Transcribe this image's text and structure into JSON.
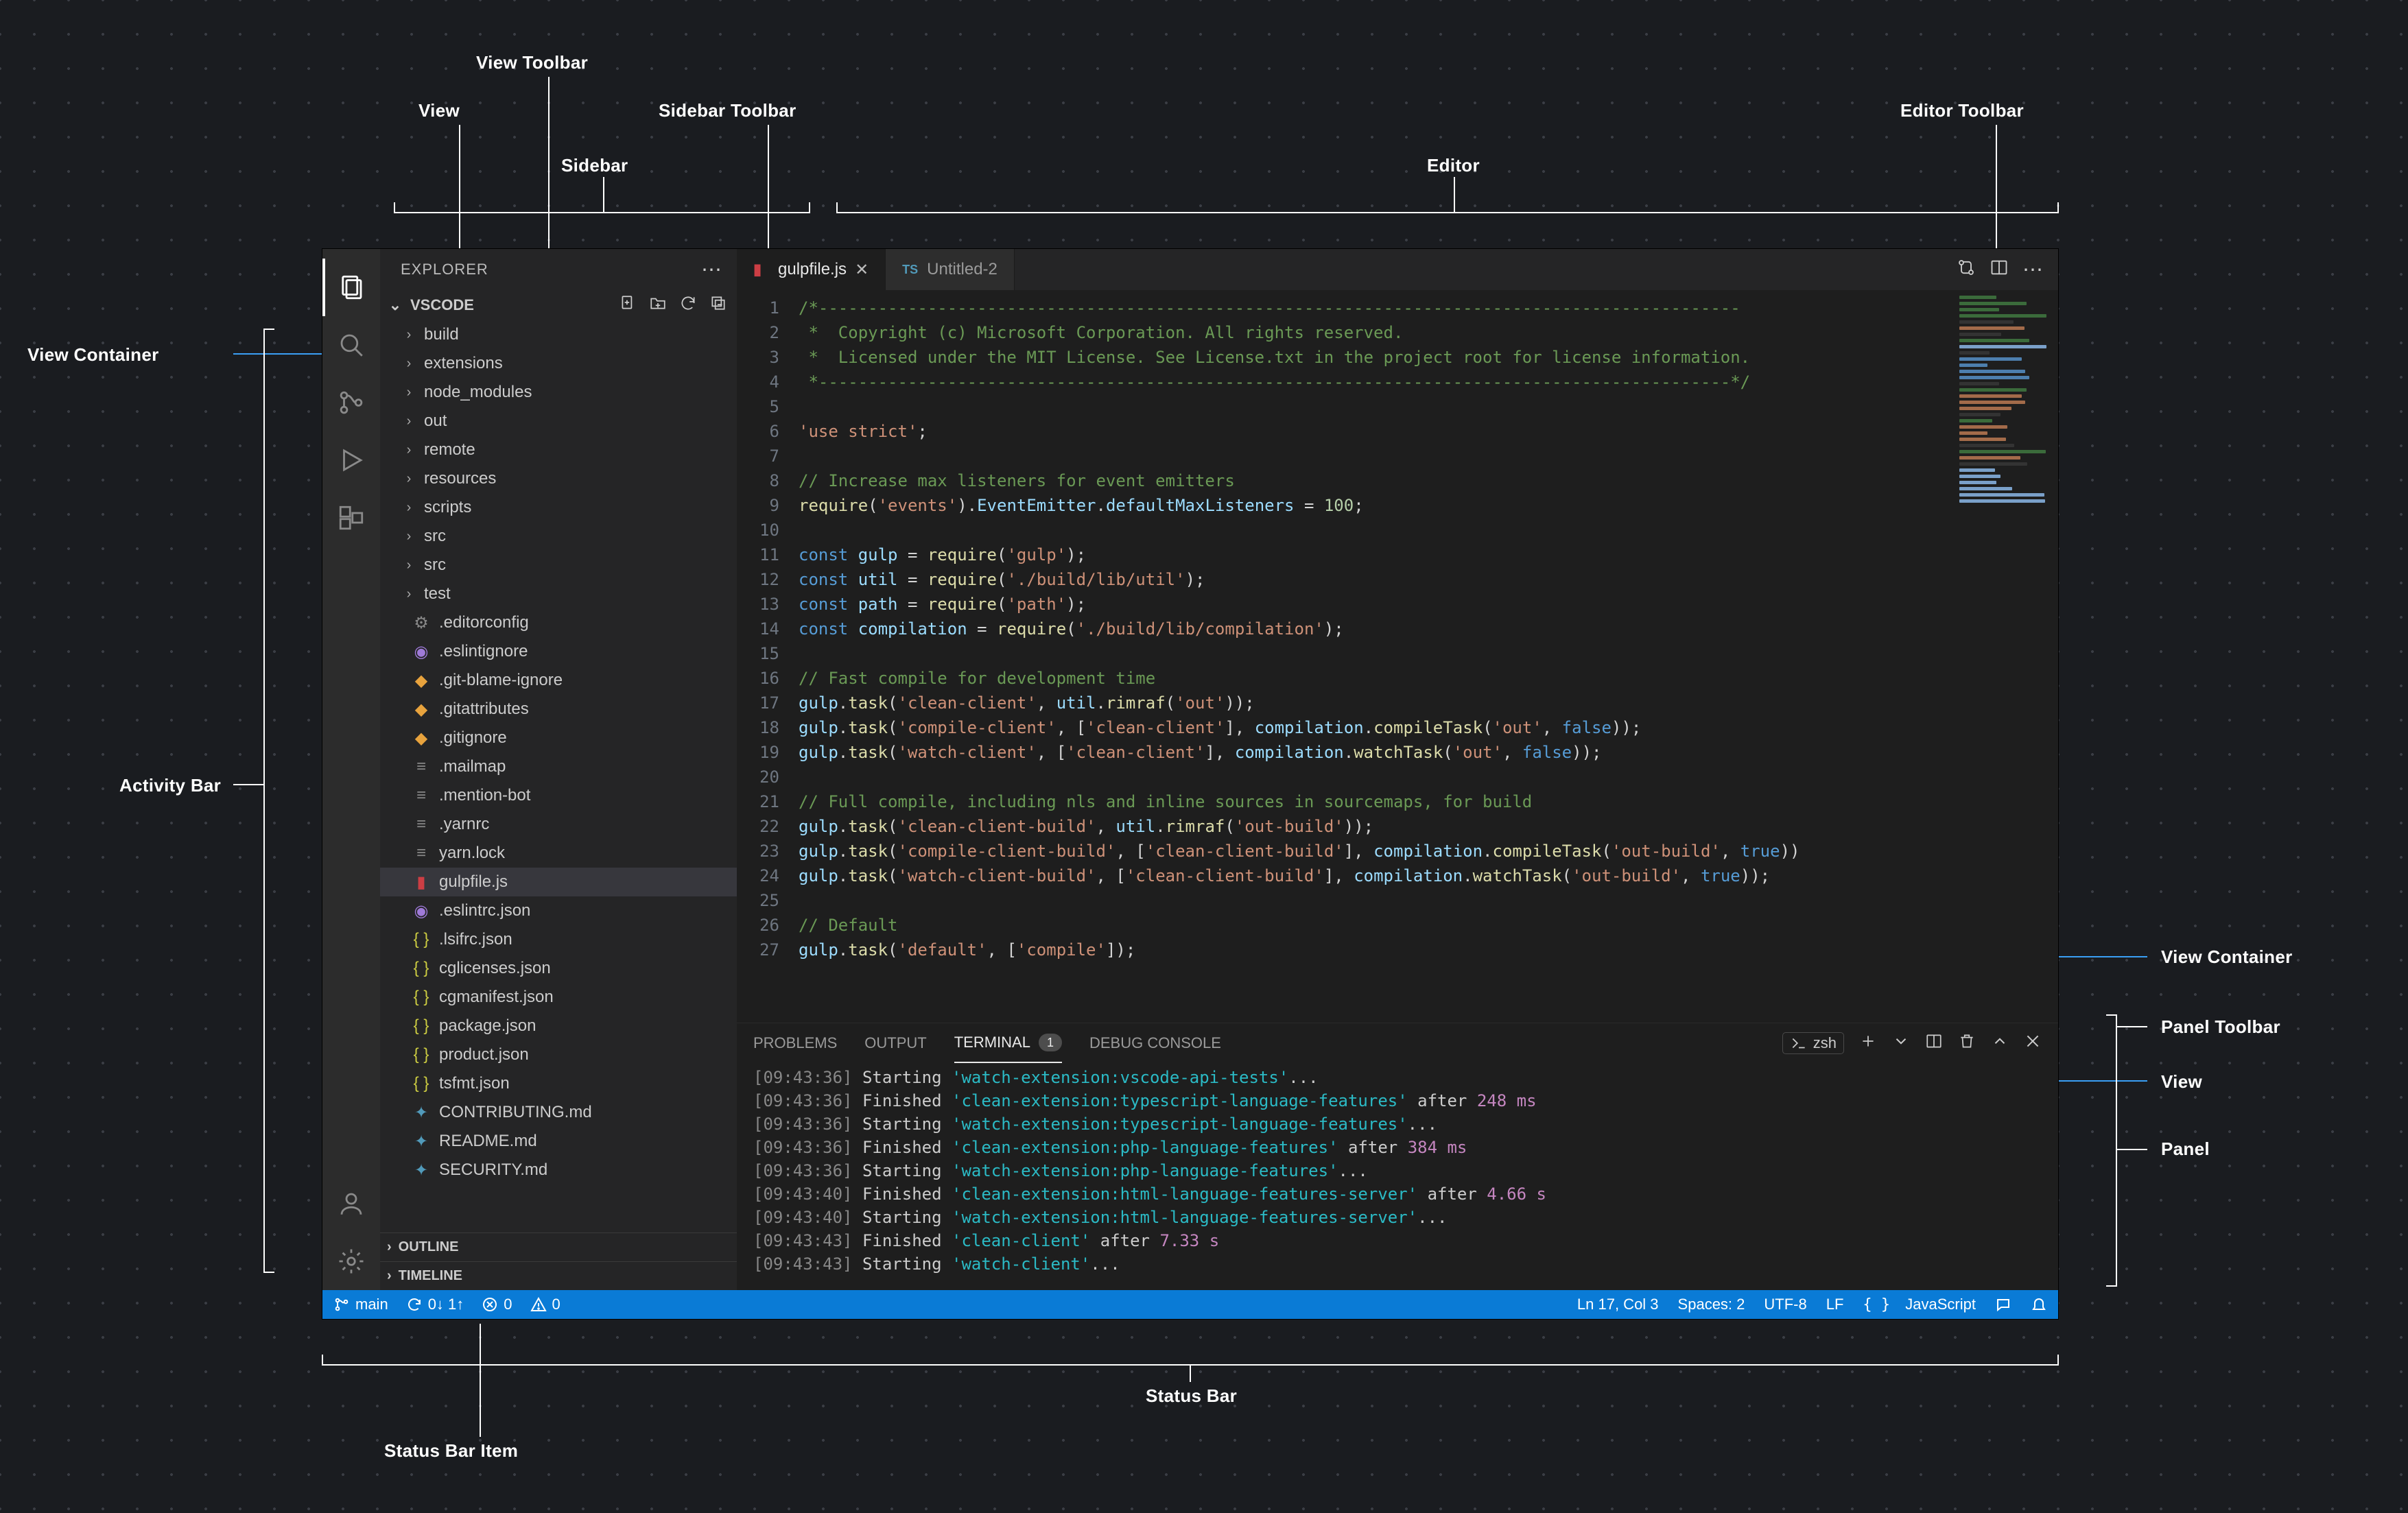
{
  "annotations": {
    "view_toolbar": "View Toolbar",
    "view": "View",
    "sidebar_toolbar": "Sidebar Toolbar",
    "sidebar": "Sidebar",
    "editor": "Editor",
    "editor_toolbar": "Editor Toolbar",
    "view_container_left": "View Container",
    "activity_bar": "Activity Bar",
    "view_container_right": "View Container",
    "panel_toolbar": "Panel Toolbar",
    "view_right": "View",
    "panel": "Panel",
    "status_bar": "Status Bar",
    "status_bar_item": "Status Bar Item"
  },
  "sidebar": {
    "title": "EXPLORER",
    "section": "VSCODE",
    "folders": [
      "build",
      "extensions",
      "node_modules",
      "out",
      "remote",
      "resources",
      "scripts",
      "src",
      "src",
      "test"
    ],
    "files": [
      {
        "label": ".editorconfig",
        "iconClass": "fi-gear",
        "glyph": "⚙"
      },
      {
        "label": ".eslintignore",
        "iconClass": "fi-purple",
        "glyph": "◉"
      },
      {
        "label": ".git-blame-ignore",
        "iconClass": "fi-orange",
        "glyph": "◆"
      },
      {
        "label": ".gitattributes",
        "iconClass": "fi-orange",
        "glyph": "◆"
      },
      {
        "label": ".gitignore",
        "iconClass": "fi-orange",
        "glyph": "◆"
      },
      {
        "label": ".mailmap",
        "iconClass": "fi-gray",
        "glyph": "≡"
      },
      {
        "label": ".mention-bot",
        "iconClass": "fi-gray",
        "glyph": "≡"
      },
      {
        "label": ".yarnrc",
        "iconClass": "fi-gray",
        "glyph": "≡"
      },
      {
        "label": "yarn.lock",
        "iconClass": "fi-gray",
        "glyph": "≡"
      },
      {
        "label": "gulpfile.js",
        "iconClass": "fi-red",
        "glyph": "▮",
        "selected": true
      },
      {
        "label": ".eslintrc.json",
        "iconClass": "fi-purple",
        "glyph": "◉"
      },
      {
        "label": ".lsifrc.json",
        "iconClass": "fi-yellow",
        "glyph": "{ }"
      },
      {
        "label": "cglicenses.json",
        "iconClass": "fi-yellow",
        "glyph": "{ }"
      },
      {
        "label": "cgmanifest.json",
        "iconClass": "fi-yellow",
        "glyph": "{ }"
      },
      {
        "label": "package.json",
        "iconClass": "fi-yellow",
        "glyph": "{ }"
      },
      {
        "label": "product.json",
        "iconClass": "fi-yellow",
        "glyph": "{ }"
      },
      {
        "label": "tsfmt.json",
        "iconClass": "fi-yellow",
        "glyph": "{ }"
      },
      {
        "label": "CONTRIBUTING.md",
        "iconClass": "fi-blue",
        "glyph": "✦"
      },
      {
        "label": "README.md",
        "iconClass": "fi-blue",
        "glyph": "✦"
      },
      {
        "label": "SECURITY.md",
        "iconClass": "fi-blue",
        "glyph": "✦"
      }
    ],
    "outline": "OUTLINE",
    "timeline": "TIMELINE"
  },
  "tabs": [
    {
      "label": "gulpfile.js",
      "active": true,
      "iconClass": "fi-red",
      "glyph": "▮"
    },
    {
      "label": "Untitled-2",
      "active": false,
      "iconClass": "fi-blue",
      "glyph": "TS"
    }
  ],
  "code": {
    "lines": [
      {
        "n": 1,
        "html": "<span class='c-cmt'>/*---------------------------------------------------------------------------------------------</span>"
      },
      {
        "n": 2,
        "html": "<span class='c-cmt'> *  Copyright (c) Microsoft Corporation. All rights reserved.</span>"
      },
      {
        "n": 3,
        "html": "<span class='c-cmt'> *  Licensed under the MIT License. See License.txt in the project root for license information.</span>"
      },
      {
        "n": 4,
        "html": "<span class='c-cmt'> *--------------------------------------------------------------------------------------------*/</span>"
      },
      {
        "n": 5,
        "html": ""
      },
      {
        "n": 6,
        "html": "<span class='c-str'>'use strict'</span><span class='c-pn'>;</span>"
      },
      {
        "n": 7,
        "html": ""
      },
      {
        "n": 8,
        "html": "<span class='c-cmt'>// Increase max listeners for event emitters</span>"
      },
      {
        "n": 9,
        "html": "<span class='c-fn'>require</span>(<span class='c-str'>'events'</span>).<span class='c-var'>EventEmitter</span>.<span class='c-var'>defaultMaxListeners</span> = <span class='c-num'>100</span>;"
      },
      {
        "n": 10,
        "html": ""
      },
      {
        "n": 11,
        "html": "<span class='c-kw'>const</span> <span class='c-var'>gulp</span> = <span class='c-fn'>require</span>(<span class='c-str'>'gulp'</span>);"
      },
      {
        "n": 12,
        "html": "<span class='c-kw'>const</span> <span class='c-var'>util</span> = <span class='c-fn'>require</span>(<span class='c-str'>'./build/lib/util'</span>);"
      },
      {
        "n": 13,
        "html": "<span class='c-kw'>const</span> <span class='c-var'>path</span> = <span class='c-fn'>require</span>(<span class='c-str'>'path'</span>);"
      },
      {
        "n": 14,
        "html": "<span class='c-kw'>const</span> <span class='c-var'>compilation</span> = <span class='c-fn'>require</span>(<span class='c-str'>'./build/lib/compilation'</span>);"
      },
      {
        "n": 15,
        "html": ""
      },
      {
        "n": 16,
        "html": "<span class='c-cmt'>// Fast compile for development time</span>"
      },
      {
        "n": 17,
        "html": "<span class='c-var'>gulp</span>.<span class='c-fn'>task</span>(<span class='c-str'>'clean-client'</span>, <span class='c-var'>util</span>.<span class='c-fn'>rimraf</span>(<span class='c-str'>'out'</span>));"
      },
      {
        "n": 18,
        "html": "<span class='c-var'>gulp</span>.<span class='c-fn'>task</span>(<span class='c-str'>'compile-client'</span>, [<span class='c-str'>'clean-client'</span>], <span class='c-var'>compilation</span>.<span class='c-fn'>compileTask</span>(<span class='c-str'>'out'</span>, <span class='c-kw'>false</span>));"
      },
      {
        "n": 19,
        "html": "<span class='c-var'>gulp</span>.<span class='c-fn'>task</span>(<span class='c-str'>'watch-client'</span>, [<span class='c-str'>'clean-client'</span>], <span class='c-var'>compilation</span>.<span class='c-fn'>watchTask</span>(<span class='c-str'>'out'</span>, <span class='c-kw'>false</span>));"
      },
      {
        "n": 20,
        "html": ""
      },
      {
        "n": 21,
        "html": "<span class='c-cmt'>// Full compile, including nls and inline sources in sourcemaps, for build</span>"
      },
      {
        "n": 22,
        "html": "<span class='c-var'>gulp</span>.<span class='c-fn'>task</span>(<span class='c-str'>'clean-client-build'</span>, <span class='c-var'>util</span>.<span class='c-fn'>rimraf</span>(<span class='c-str'>'out-build'</span>));"
      },
      {
        "n": 23,
        "html": "<span class='c-var'>gulp</span>.<span class='c-fn'>task</span>(<span class='c-str'>'compile-client-build'</span>, [<span class='c-str'>'clean-client-build'</span>], <span class='c-var'>compilation</span>.<span class='c-fn'>compileTask</span>(<span class='c-str'>'out-build'</span>, <span class='c-kw'>true</span>))"
      },
      {
        "n": 24,
        "html": "<span class='c-var'>gulp</span>.<span class='c-fn'>task</span>(<span class='c-str'>'watch-client-build'</span>, [<span class='c-str'>'clean-client-build'</span>], <span class='c-var'>compilation</span>.<span class='c-fn'>watchTask</span>(<span class='c-str'>'out-build'</span>, <span class='c-kw'>true</span>));"
      },
      {
        "n": 25,
        "html": ""
      },
      {
        "n": 26,
        "html": "<span class='c-cmt'>// Default</span>"
      },
      {
        "n": 27,
        "html": "<span class='c-var'>gulp</span>.<span class='c-fn'>task</span>(<span class='c-str'>'default'</span>, [<span class='c-str'>'compile'</span>]);"
      }
    ]
  },
  "panel": {
    "tabs": {
      "problems": "PROBLEMS",
      "output": "OUTPUT",
      "terminal": "TERMINAL",
      "terminal_badge": "1",
      "debug": "DEBUG CONSOLE"
    },
    "shell": "zsh",
    "lines": [
      {
        "ts": "[09:43:36]",
        "a": "Starting",
        "task": "'watch-extension:vscode-api-tests'",
        "tail": "..."
      },
      {
        "ts": "[09:43:36]",
        "a": "Finished",
        "task": "'clean-extension:typescript-language-features'",
        "tail": " after ",
        "dur": "248 ms"
      },
      {
        "ts": "[09:43:36]",
        "a": "Starting",
        "task": "'watch-extension:typescript-language-features'",
        "tail": "..."
      },
      {
        "ts": "[09:43:36]",
        "a": "Finished",
        "task": "'clean-extension:php-language-features'",
        "tail": " after ",
        "dur": "384 ms"
      },
      {
        "ts": "[09:43:36]",
        "a": "Starting",
        "task": "'watch-extension:php-language-features'",
        "tail": "..."
      },
      {
        "ts": "[09:43:40]",
        "a": "Finished",
        "task": "'clean-extension:html-language-features-server'",
        "tail": " after ",
        "dur": "4.66 s"
      },
      {
        "ts": "[09:43:40]",
        "a": "Starting",
        "task": "'watch-extension:html-language-features-server'",
        "tail": "..."
      },
      {
        "ts": "[09:43:43]",
        "a": "Finished",
        "task": "'clean-client'",
        "tail": " after ",
        "dur": "7.33 s"
      },
      {
        "ts": "[09:43:43]",
        "a": "Starting",
        "task": "'watch-client'",
        "tail": "..."
      }
    ]
  },
  "statusbar": {
    "branch": "main",
    "sync": "0↓ 1↑",
    "errors": "0",
    "warnings": "0",
    "lncol": "Ln 17, Col 3",
    "spaces": "Spaces: 2",
    "encoding": "UTF-8",
    "eol": "LF",
    "lang": "JavaScript"
  }
}
